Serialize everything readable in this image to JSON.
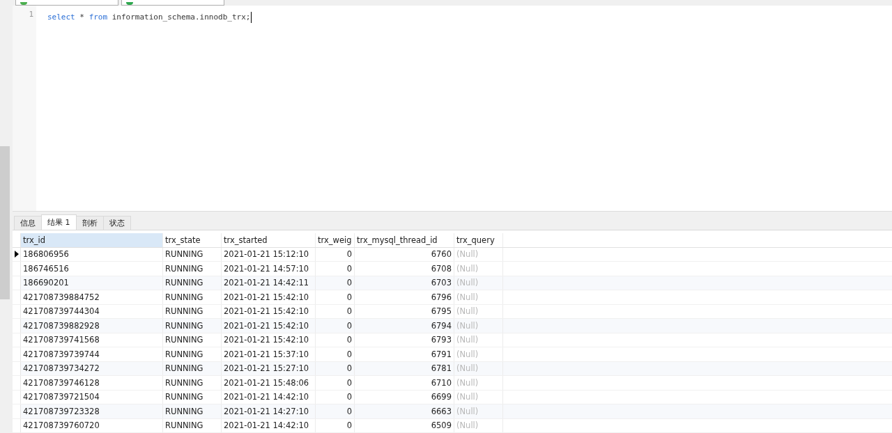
{
  "toolbar": {
    "buttons": [
      {
        "kind": "plain"
      },
      {
        "kind": "run"
      }
    ]
  },
  "editor": {
    "lines": [
      {
        "number": "1",
        "tokens": [
          {
            "text": "select",
            "kind": "keyword"
          },
          {
            "text": " * ",
            "kind": "plain"
          },
          {
            "text": "from",
            "kind": "keyword"
          },
          {
            "text": " information_schema.innodb_trx;",
            "kind": "plain"
          }
        ]
      }
    ]
  },
  "tabs": [
    {
      "label": "信息",
      "selected": false
    },
    {
      "label": "结果 1",
      "selected": true
    },
    {
      "label": "剖析",
      "selected": false
    },
    {
      "label": "状态",
      "selected": false
    }
  ],
  "table": {
    "columns": [
      {
        "label": "trx_id",
        "selected": true
      },
      {
        "label": "trx_state",
        "selected": false
      },
      {
        "label": "trx_started",
        "selected": false
      },
      {
        "label": "trx_weig",
        "selected": false
      },
      {
        "label": "trx_mysql_thread_id",
        "selected": false
      },
      {
        "label": "trx_query",
        "selected": false
      }
    ],
    "rows": [
      {
        "current": true,
        "cells": [
          "186806956",
          "RUNNING",
          "2021-01-21 15:12:10",
          "0",
          "6760",
          "(Null)"
        ]
      },
      {
        "current": false,
        "cells": [
          "186746516",
          "RUNNING",
          "2021-01-21 14:57:10",
          "0",
          "6708",
          "(Null)"
        ]
      },
      {
        "current": false,
        "cells": [
          "186690201",
          "RUNNING",
          "2021-01-21 14:42:11",
          "0",
          "6703",
          "(Null)"
        ]
      },
      {
        "current": false,
        "cells": [
          "421708739884752",
          "RUNNING",
          "2021-01-21 15:42:10",
          "0",
          "6796",
          "(Null)"
        ]
      },
      {
        "current": false,
        "cells": [
          "421708739744304",
          "RUNNING",
          "2021-01-21 15:42:10",
          "0",
          "6795",
          "(Null)"
        ]
      },
      {
        "current": false,
        "cells": [
          "421708739882928",
          "RUNNING",
          "2021-01-21 15:42:10",
          "0",
          "6794",
          "(Null)"
        ]
      },
      {
        "current": false,
        "cells": [
          "421708739741568",
          "RUNNING",
          "2021-01-21 15:42:10",
          "0",
          "6793",
          "(Null)"
        ]
      },
      {
        "current": false,
        "cells": [
          "421708739739744",
          "RUNNING",
          "2021-01-21 15:37:10",
          "0",
          "6791",
          "(Null)"
        ]
      },
      {
        "current": false,
        "cells": [
          "421708739734272",
          "RUNNING",
          "2021-01-21 15:27:10",
          "0",
          "6781",
          "(Null)"
        ]
      },
      {
        "current": false,
        "cells": [
          "421708739746128",
          "RUNNING",
          "2021-01-21 15:48:06",
          "0",
          "6710",
          "(Null)"
        ]
      },
      {
        "current": false,
        "cells": [
          "421708739721504",
          "RUNNING",
          "2021-01-21 14:42:10",
          "0",
          "6699",
          "(Null)"
        ]
      },
      {
        "current": false,
        "cells": [
          "421708739723328",
          "RUNNING",
          "2021-01-21 14:27:10",
          "0",
          "6663",
          "(Null)"
        ]
      },
      {
        "current": false,
        "cells": [
          "421708739760720",
          "RUNNING",
          "2021-01-21 14:42:10",
          "0",
          "6509",
          "(Null)"
        ]
      }
    ]
  }
}
